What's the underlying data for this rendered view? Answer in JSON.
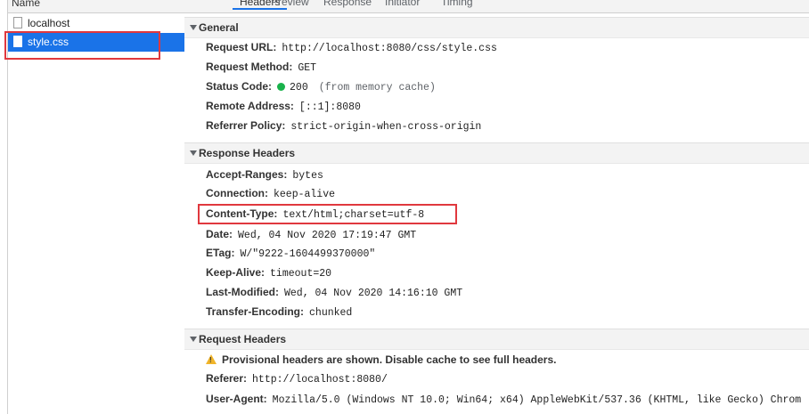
{
  "request_list": {
    "header": "Name",
    "items": [
      {
        "label": "localhost"
      },
      {
        "label": "style.css"
      }
    ]
  },
  "tabs": [
    "Headers",
    "Preview",
    "Response",
    "Initiator",
    "Timing"
  ],
  "general": {
    "title": "General",
    "rows": [
      {
        "key": "Request URL:",
        "value": "http://localhost:8080/css/style.css"
      },
      {
        "key": "Request Method:",
        "value": "GET"
      },
      {
        "key": "Status Code:",
        "value": "200",
        "extra": "(from memory cache)"
      },
      {
        "key": "Remote Address:",
        "value": "[::1]:8080"
      },
      {
        "key": "Referrer Policy:",
        "value": "strict-origin-when-cross-origin"
      }
    ]
  },
  "response_headers": {
    "title": "Response Headers",
    "rows": [
      {
        "key": "Accept-Ranges:",
        "value": "bytes"
      },
      {
        "key": "Connection:",
        "value": "keep-alive"
      },
      {
        "key": "Content-Type:",
        "value": "text/html;charset=utf-8"
      },
      {
        "key": "Date:",
        "value": "Wed, 04 Nov 2020 17:19:47 GMT"
      },
      {
        "key": "ETag:",
        "value": "W/\"9222-1604499370000\""
      },
      {
        "key": "Keep-Alive:",
        "value": "timeout=20"
      },
      {
        "key": "Last-Modified:",
        "value": "Wed, 04 Nov 2020 14:16:10 GMT"
      },
      {
        "key": "Transfer-Encoding:",
        "value": "chunked"
      }
    ]
  },
  "request_headers": {
    "title": "Request Headers",
    "warning": "Provisional headers are shown. Disable cache to see full headers.",
    "rows": [
      {
        "key": "Referer:",
        "value": "http://localhost:8080/"
      },
      {
        "key": "User-Agent:",
        "value": "Mozilla/5.0 (Windows NT 10.0; Win64; x64) AppleWebKit/537.36 (KHTML, like Gecko) Chrom"
      }
    ]
  },
  "colors": {
    "selection": "#1a73e8",
    "highlight_box": "#e0383e",
    "status_ok": "#19b24b",
    "warning": "#f0b429"
  },
  "icons": {
    "file": "file-icon",
    "collapse": "triangle-down-icon",
    "warning": "warning-icon",
    "status": "status-dot-icon"
  }
}
